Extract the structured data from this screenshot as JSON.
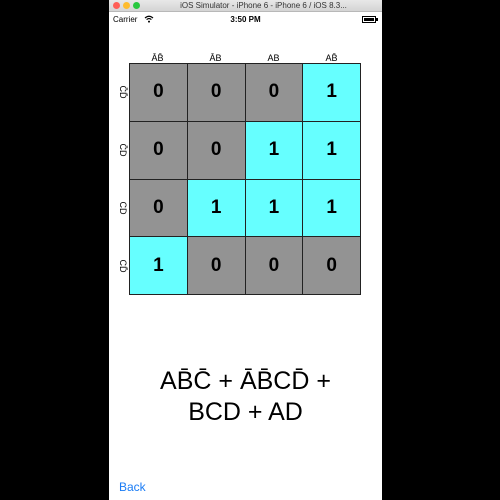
{
  "simulator": {
    "title": "iOS Simulator - iPhone 6 - iPhone 6 / iOS 8.3..."
  },
  "status_bar": {
    "carrier": "Carrier",
    "time": "3:50 PM"
  },
  "kmap": {
    "col_labels": [
      "ĀB̄",
      "ĀB",
      "AB",
      "AB̄"
    ],
    "row_labels": [
      "C̄D̄",
      "C̄D",
      "CD",
      "CD̄"
    ],
    "cells": [
      [
        "0",
        "0",
        "0",
        "1"
      ],
      [
        "0",
        "0",
        "1",
        "1"
      ],
      [
        "0",
        "1",
        "1",
        "1"
      ],
      [
        "1",
        "0",
        "0",
        "0"
      ]
    ],
    "colors": {
      "off": "#939393",
      "on": "#66ffff"
    }
  },
  "expression": {
    "line1": "AB̄C̄ + ĀB̄CD̄ +",
    "line2": "BCD + AD"
  },
  "nav": {
    "back_label": "Back"
  }
}
